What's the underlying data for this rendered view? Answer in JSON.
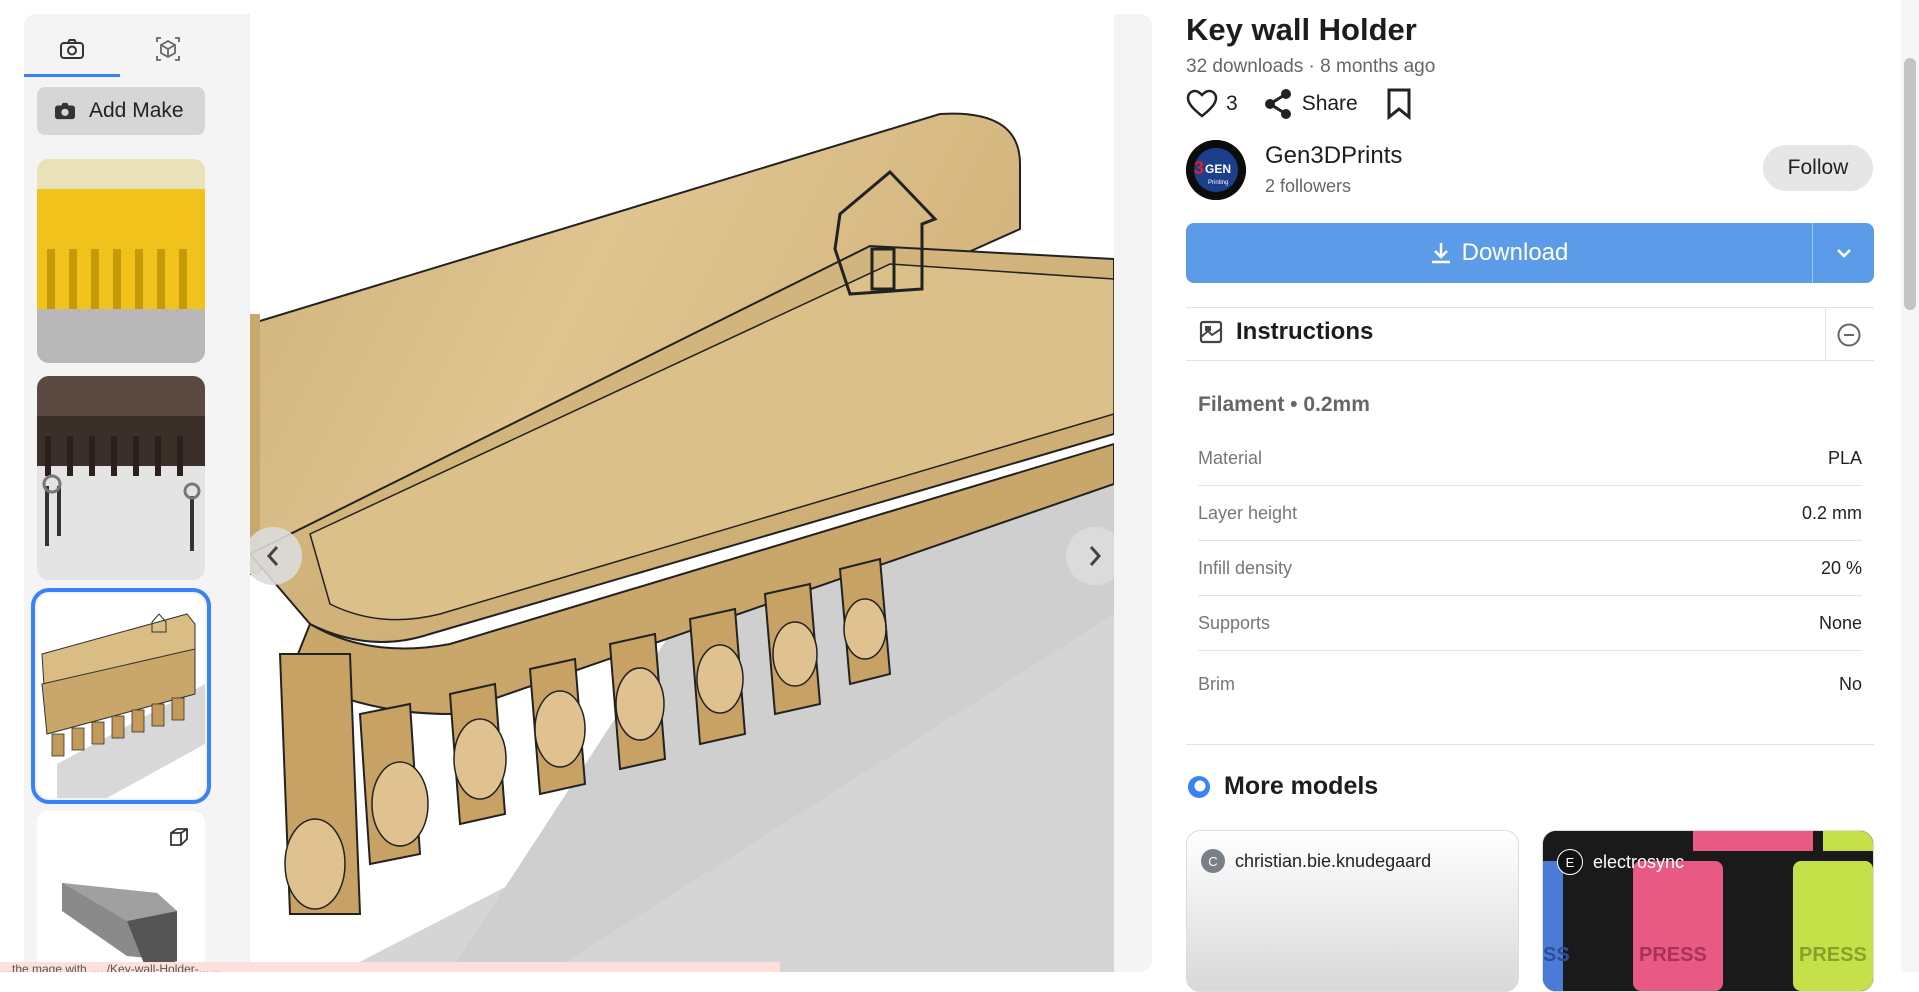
{
  "gallery": {
    "add_make_label": "Add Make",
    "tabs": [
      {
        "icon": "camera-icon"
      },
      {
        "icon": "cube-3d-icon"
      }
    ]
  },
  "status_url": "…the mage with .... /Key-wall-Holder-... ...",
  "model": {
    "title": "Key wall Holder",
    "meta": "32 downloads · 8 months ago",
    "likes": "3",
    "share_label": "Share"
  },
  "creator": {
    "name": "Gen3DPrints",
    "followers": "2 followers",
    "avatar_text": "3GEN",
    "avatar_sub": "Printing",
    "follow_label": "Follow"
  },
  "download": {
    "label": "Download"
  },
  "instructions": {
    "title": "Instructions",
    "filament_heading": "Filament • 0.2mm",
    "properties": [
      {
        "key": "Material",
        "value": "PLA"
      },
      {
        "key": "Layer height",
        "value": "0.2 mm"
      },
      {
        "key": "Infill density",
        "value": "20 %"
      },
      {
        "key": "Supports",
        "value": "None"
      },
      {
        "key": "Brim",
        "value": "No"
      }
    ]
  },
  "more_models": {
    "title": "More models",
    "cards": [
      {
        "user": "christian.bie.knudegaard",
        "initial": "C"
      },
      {
        "user": "electrosync",
        "initial": "E"
      }
    ]
  },
  "colors": {
    "accent": "#3b82f6",
    "download_bg": "#5b9be8",
    "wood": "#d9bd85"
  }
}
